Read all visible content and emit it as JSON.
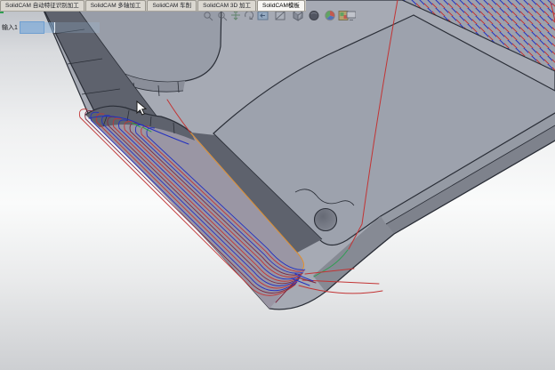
{
  "tab_bar": {
    "tabs": [
      {
        "label": "SolidCAM 自动特征识别加工",
        "active": false
      },
      {
        "label": "SolidCAM 多轴加工",
        "active": false
      },
      {
        "label": "SolidCAM 车削",
        "active": false
      },
      {
        "label": "SolidCAM 3D 加工",
        "active": false
      },
      {
        "label": "SolidCAM模板",
        "active": true
      }
    ]
  },
  "heads_up_toolbar": {
    "icons": [
      "zoom-window-icon",
      "zoom-fit-icon",
      "pan-icon",
      "rotate-view-icon",
      "previous-view-icon",
      "section-view-icon",
      "view-orientation-icon",
      "display-style-icon",
      "appearance-icon",
      "scene-icon",
      "fullscreen-icon"
    ]
  },
  "feature_tree": {
    "selected_item": "输入1"
  },
  "model": {
    "toolpath_pass_count": 13,
    "colors": {
      "part_top": "#a6aab4",
      "pocket_floor": "#9da2ad",
      "pocket_floor_dark": "#989da8",
      "wall_dark": "#5e626d",
      "wall_medium": "#7e828c",
      "wall_chamfer": "#959aa4",
      "machined_wall": "#9a96a4",
      "edge": "#2a2e37",
      "toolpath_feed": "#2330c0",
      "toolpath_rapid": "#c23434",
      "toolpath_link": "#7c2a42",
      "toolpath_lead": "#2f9e52",
      "selected_edge": "#e0902f"
    }
  }
}
